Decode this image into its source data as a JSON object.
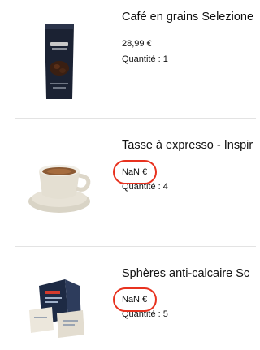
{
  "cart": {
    "items": [
      {
        "title": "Café en grains Selezione",
        "price": "28,99 €",
        "quantity": "Quantité : 1",
        "image_icon": "coffee-bag-icon"
      },
      {
        "title": "Tasse à expresso - Inspir",
        "price": "NaN €",
        "quantity": "Quantité : 4",
        "image_icon": "espresso-cup-icon"
      },
      {
        "title": "Sphères anti-calcaire Sc",
        "price": "NaN €",
        "quantity": "Quantité : 5",
        "image_icon": "descaler-pack-icon"
      }
    ]
  },
  "colors": {
    "highlight": "#e8321f",
    "divider": "#e3e3e3",
    "text": "#111111"
  }
}
